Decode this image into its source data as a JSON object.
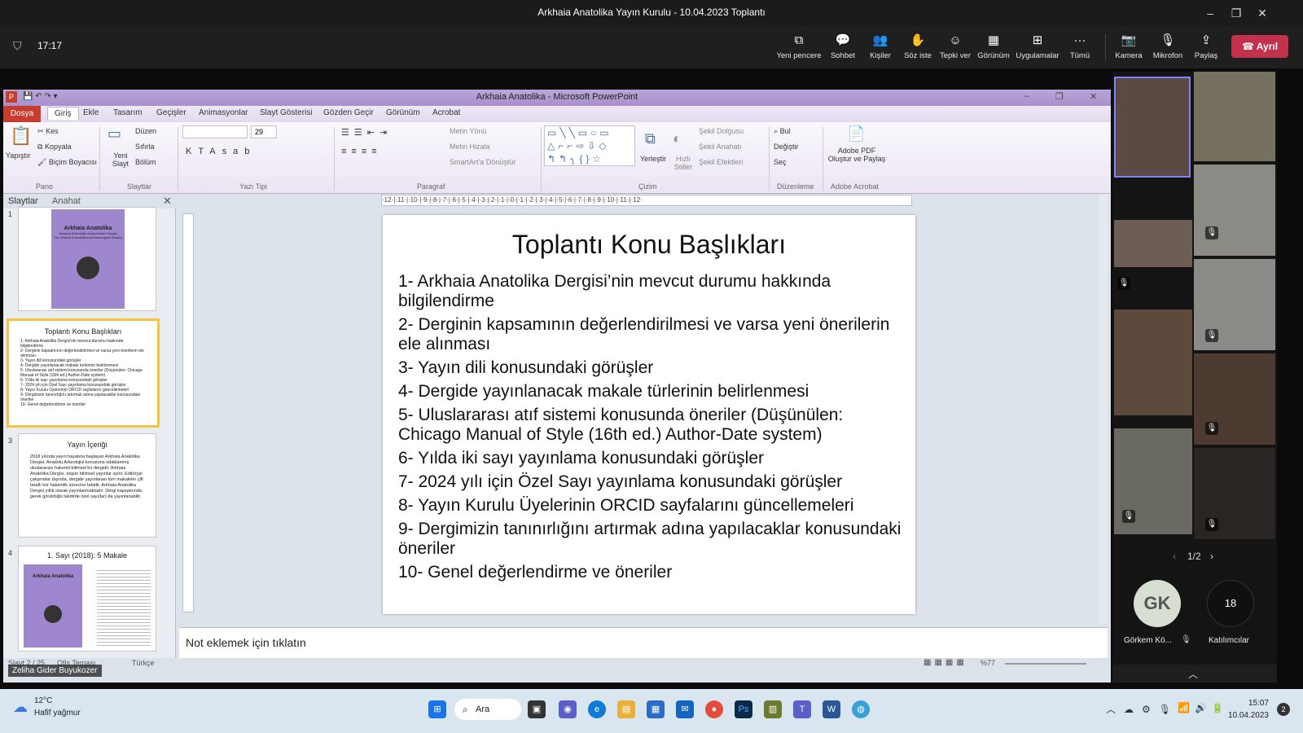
{
  "teams": {
    "window_title": "Arkhaia Anatolika Yayın Kurulu - 10.04.2023 Toplantı",
    "timer": "17:17",
    "toolbar": [
      {
        "label": "Yeni pencere",
        "icon": "new-window-icon"
      },
      {
        "label": "Sohbet",
        "icon": "chat-icon"
      },
      {
        "label": "Kişiler",
        "icon": "people-icon"
      },
      {
        "label": "Söz iste",
        "icon": "raise-hand-icon"
      },
      {
        "label": "Tepki ver",
        "icon": "react-icon"
      },
      {
        "label": "Görünüm",
        "icon": "view-icon"
      },
      {
        "label": "Uygulamalar",
        "icon": "apps-icon"
      },
      {
        "label": "Tümü",
        "icon": "more-icon"
      },
      {
        "label": "Kamera",
        "icon": "camera-off-icon"
      },
      {
        "label": "Mikrofon",
        "icon": "mic-off-icon"
      },
      {
        "label": "Paylaş",
        "icon": "share-icon"
      }
    ],
    "leave_label": "Ayrıl",
    "pager": "1/2",
    "avatar_initials": "GK",
    "avatar_name": "Görkem Kö...",
    "participant_count": "18",
    "participants_label": "Katılımcılar",
    "presenter_name": "Zeliha Gider Buyukozer"
  },
  "ppt": {
    "window_title": "Arkhaia Anatolika - Microsoft PowerPoint",
    "file_tab": "Dosya",
    "tabs": [
      "Giriş",
      "Ekle",
      "Tasarım",
      "Geçişler",
      "Animasyonlar",
      "Slayt Gösterisi",
      "Gözden Geçir",
      "Görünüm",
      "Acrobat"
    ],
    "ribbon": {
      "paste": "Yapıştır",
      "cut": "Kes",
      "copy": "Kopyala",
      "format_painter": "Biçim Boyacısı",
      "new_slide": "Yeni Slayt",
      "layout": "Düzen",
      "reset": "Sıfırla",
      "section": "Bölüm",
      "font_size": "29",
      "text_direction": "Metin Yönü",
      "align_text": "Metin Hizala",
      "smartart": "SmartArt'a Dönüştür",
      "arrange": "Yerleştir",
      "quick_styles": "Hızlı Stiller",
      "shape_fill": "Şekil Dolgusu",
      "shape_outline": "Şekil Anahatı",
      "shape_effects": "Şekil Efektleri",
      "find": "Bul",
      "replace": "Değiştir",
      "select": "Seç",
      "adobe_pdf": "Adobe PDF Oluştur ve Paylaş",
      "groups": {
        "clipboard": "Pano",
        "slides": "Slaytlar",
        "font": "Yazı Tipi",
        "paragraph": "Paragraf",
        "drawing": "Çizim",
        "editing": "Düzenleme",
        "acrobat": "Adobe Acrobat"
      }
    },
    "pane_tabs": [
      "Slaytlar",
      "Anahat"
    ],
    "thumbnails": [
      {
        "num": "1",
        "title": "Arkhaia Anatolika",
        "lines": [
          "Anadolu Arkeolojisi Araştırmaları Dergisi",
          "The Journal of Anatolian Archaeological Studies"
        ]
      },
      {
        "num": "2",
        "title": "Toplantı Konu Başlıkları",
        "lines": [
          "1- Arkhaia Anatolika Dergisi'nin mevcut durumu hakkında bilgilendirme",
          "2- Derginin kapsamının değerlendirilmesi ve varsa yeni önerilerin ele alınması",
          "3- Yayın dili konusundaki görüşler",
          "4- Dergide yayınlanacak makale türlerinin belirlenmesi",
          "5- Uluslararası atıf sistemi konusunda öneriler (Düşünülen: Chicago Manual of Style (16th ed.) Author-Date system)",
          "6- Yılda iki sayı yayınlama konusundaki görüşler",
          "7- 2024 yılı için Özel Sayı yayınlama konusundaki görüşler",
          "8- Yayın Kurulu Üyelerinin ORCID sayfalarını güncellemeleri",
          "9- Dergimizin tanınırlığını artırmak adına yapılacaklar konusundaki öneriler",
          "10- Genel değerlendirme ve öneriler"
        ]
      },
      {
        "num": "3",
        "title": "Yayın İçeriği",
        "lines": [
          "2018 yılında yayın hayatına başlayan Arkhaia Anatolika Dergisi, Anadolu Arkeolojisi konusuna odaklanmış uluslararası hakemli bilimsel bir dergidir. Arkhaia Anatolika Dergisi, özgün bilimsel yayınlar içerir. Editöryal çalışmalar dışında, dergide yayınlanan tüm makaleler çift taraflı kör hakemlik sürecine tabidir. Arkhaia Anatolika Dergisi yıllık olarak yayınlanmaktadır. Dergi kapsamında gerek görüldüğü takdirde özel sayı(lar) da yayınlanabilir."
        ]
      },
      {
        "num": "4",
        "title": "1. Sayı (2018): 5 Makale",
        "lines": []
      }
    ],
    "slide": {
      "title": "Toplantı Konu Başlıkları",
      "items": [
        "1- Arkhaia Anatolika Dergisi’nin mevcut durumu hakkında bilgilendirme",
        "2- Derginin kapsamının değerlendirilmesi ve varsa yeni önerilerin ele alınması",
        "3- Yayın dili konusundaki görüşler",
        "4- Dergide yayınlanacak makale türlerinin belirlenmesi",
        "5- Uluslararası atıf sistemi konusunda öneriler (Düşünülen: Chicago Manual of Style (16th ed.) Author-Date system)",
        "6- Yılda iki sayı yayınlama konusundaki görüşler",
        "7- 2024 yılı için Özel Sayı yayınlama konusundaki görüşler",
        "8- Yayın Kurulu Üyelerinin ORCID sayfalarını güncellemeleri",
        "9- Dergimizin tanınırlığını artırmak adına yapılacaklar konusundaki öneriler",
        "10- Genel değerlendirme ve öneriler"
      ]
    },
    "notes_placeholder": "Not eklemek için tıklatın",
    "status": {
      "slide": "Slayt 2 / 25",
      "theme": "Ofis Teması",
      "language": "Türkçe",
      "zoom": "%77"
    },
    "ruler": "·12·|·11·|·10·|·9·|·8·|·7·|·6·|·5·|·4·|·3·|·2·|·1·|·0·|·1·|·2·|·3·|·4·|·5·|·6·|·7·|·8·|·9·|·10·|·11·|·12·"
  },
  "taskbar": {
    "temp": "12°C",
    "weather": "Hafif yağmur",
    "search": "Ara",
    "time": "15:07",
    "date": "10.04.2023",
    "notif_count": "2"
  },
  "colors": {
    "leave": "#c4314b",
    "ppt_file_tab": "#c63d2f",
    "thumb_cover": "#9f87cf",
    "selected_thumb": "#f4c542"
  }
}
